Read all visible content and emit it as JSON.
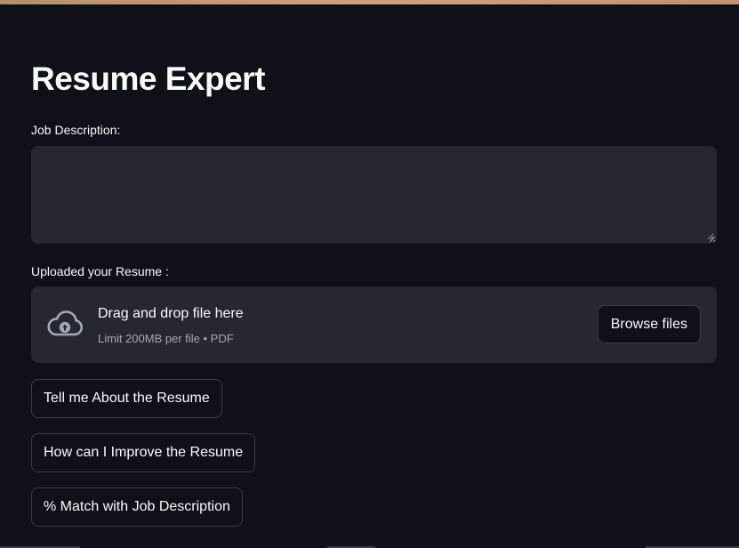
{
  "app": {
    "title": "Resume Expert"
  },
  "job_description": {
    "label": "Job Description:",
    "value": "",
    "placeholder": ""
  },
  "uploader": {
    "label": "Uploaded your Resume :",
    "drop_text": "Drag and drop file here",
    "limit_text": "Limit 200MB per file • PDF",
    "browse_label": "Browse files",
    "icon": "cloud-upload-icon"
  },
  "actions": [
    {
      "label": "Tell me About the Resume"
    },
    {
      "label": "How can I Improve the Resume"
    },
    {
      "label": "% Match with Job Description"
    }
  ],
  "colors": {
    "background": "#0e1117",
    "surface": "#262730",
    "text": "#fafafa",
    "muted_text": "#a3a8b8",
    "border": "#3a3c47"
  }
}
